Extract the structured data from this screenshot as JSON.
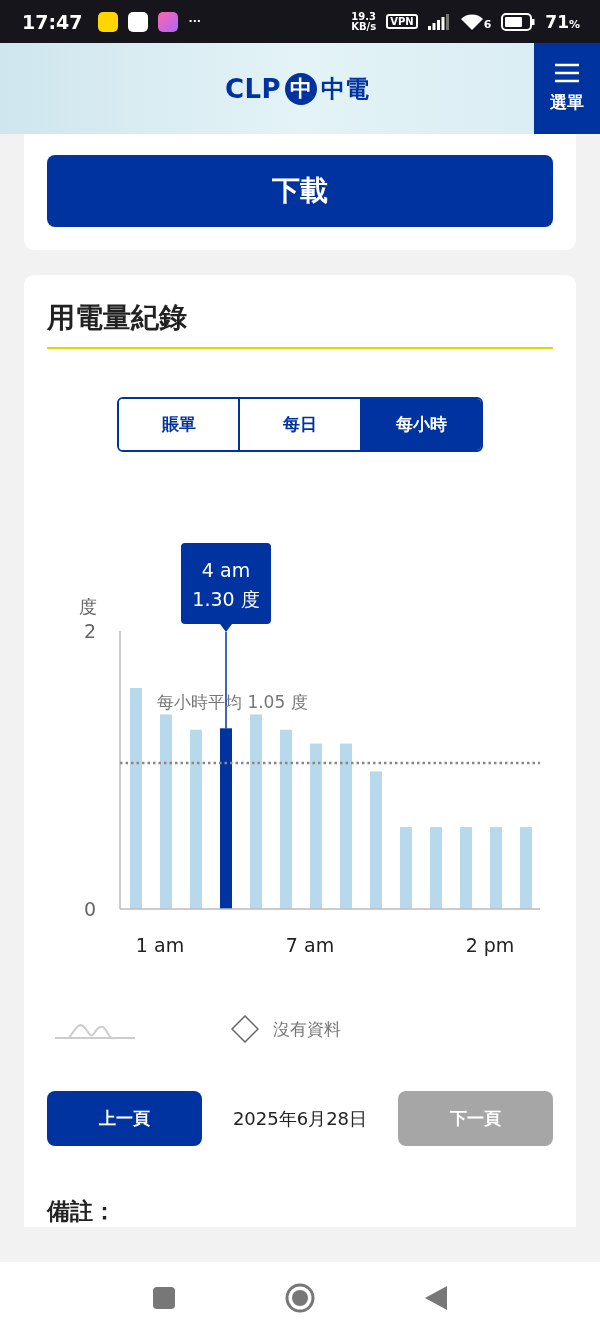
{
  "status_bar": {
    "time": "17:47",
    "more": "···",
    "speed_value": "19.3",
    "speed_unit": "KB/s",
    "vpn": "VPN",
    "wifi_badge": "6",
    "battery": "71",
    "battery_unit": "%"
  },
  "header": {
    "logo_text": "CLP",
    "logo_mark": "中",
    "logo_chinese": "中電",
    "menu_label": "選單"
  },
  "download_button": "下載",
  "usage": {
    "title": "用電量紀錄",
    "tabs": [
      {
        "label": "賬單",
        "selected": false
      },
      {
        "label": "每日",
        "selected": false
      },
      {
        "label": "每小時",
        "selected": true
      }
    ],
    "chart_data": {
      "type": "bar",
      "ylabel": "度",
      "categories": [
        null,
        "1 am",
        null,
        null,
        null,
        null,
        "7 am",
        null,
        null,
        null,
        null,
        null,
        "2 pm",
        null
      ],
      "series": [
        {
          "color": "#b8d9ec",
          "values": [
            1.59,
            1.4,
            1.29,
            null,
            1.4,
            1.29,
            1.19,
            1.19,
            0.99,
            0.59,
            0.59,
            0.59,
            0.59,
            0.59
          ]
        },
        {
          "color": "#0033a0",
          "values": [
            null,
            null,
            null,
            1.3,
            null,
            null,
            null,
            null,
            null,
            null,
            null,
            null,
            null,
            null
          ]
        }
      ],
      "ylim": [
        0,
        2
      ],
      "yticks": [
        0,
        2
      ],
      "ref_lines": [
        {
          "axis": "y",
          "value": 1.05,
          "label": "每小時平均 1.05 度"
        }
      ]
    },
    "tooltip": {
      "lines": [
        "4 am",
        "1.30 度"
      ]
    },
    "legend": [
      {
        "kind": "line"
      },
      {
        "kind": "no_data",
        "label": "沒有資料"
      }
    ],
    "pager": {
      "previous": {
        "label": "上一頁",
        "disabled": false
      },
      "date": "2025年6月28日",
      "next": {
        "label": "下一頁",
        "disabled": true
      }
    },
    "notes_title": "備註："
  }
}
